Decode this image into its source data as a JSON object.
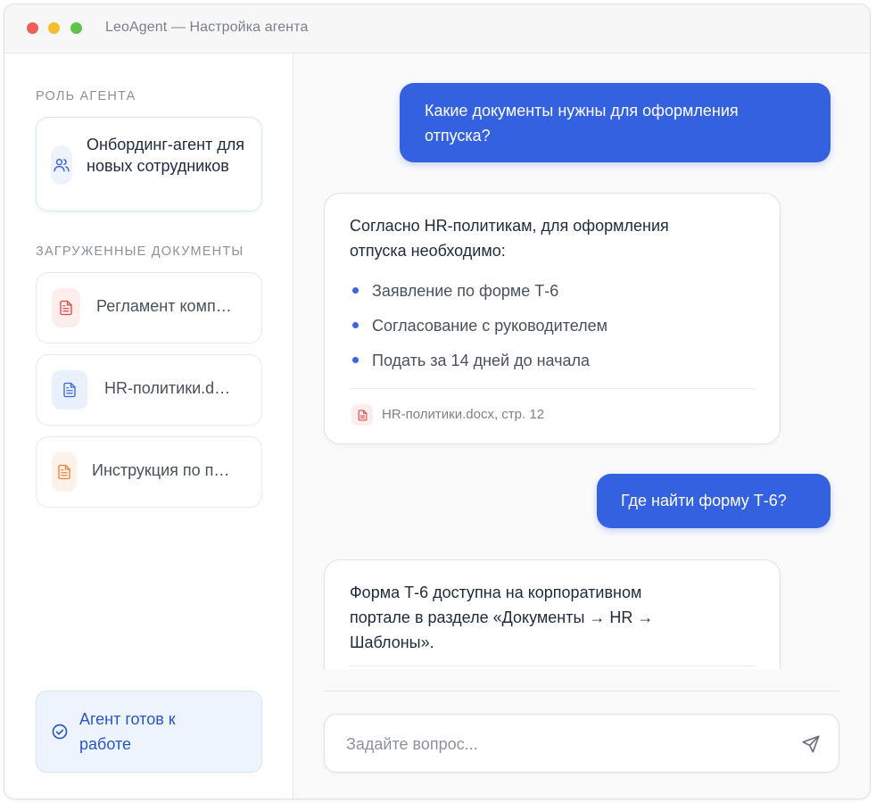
{
  "window": {
    "title": "LeoAgent — Настройка агента"
  },
  "sidebar": {
    "role_label": "РОЛЬ АГЕНТА",
    "role": {
      "icon": "users-icon",
      "text": "Онбординг-агент для новых сотрудников"
    },
    "docs_label": "ЗАГРУЖЕННЫЕ ДОКУМЕНТЫ",
    "documents": [
      {
        "name": "Регламент комп…",
        "icon": "file-text-icon",
        "color": "#d94a4a",
        "bg": "#fdeeee"
      },
      {
        "name": "HR-политики.d…",
        "icon": "file-text-icon",
        "color": "#3b67de",
        "bg": "#eaf0fc"
      },
      {
        "name": "Инструкция по п…",
        "icon": "file-text-icon",
        "color": "#e8833a",
        "bg": "#fdf1e8"
      }
    ],
    "status": {
      "text": "Агент готов к работе",
      "icon": "check-circle-icon"
    }
  },
  "chat": {
    "messages": [
      {
        "role": "user",
        "text": "Какие документы нужны для оформления отпуска?"
      },
      {
        "role": "bot",
        "text": "Согласно HR-политикам, для оформления отпуска необходимо:",
        "bullets": [
          "Заявление по форме Т-6",
          "Согласование с руководителем",
          "Подать за 14 дней до начала"
        ],
        "source": "HR-политики.docx, стр. 12"
      },
      {
        "role": "user",
        "text": "Где найти форму Т-6?"
      },
      {
        "role": "bot",
        "text": "Форма Т-6 доступна на корпоративном портале в разделе «Документы → HR → Шаблоны»."
      }
    ],
    "input": {
      "placeholder": "Задайте вопрос...",
      "value": ""
    },
    "send_icon": "send-icon"
  },
  "colors": {
    "accent": "#3361e0",
    "status_bg": "#eef4fd",
    "status_text": "#2a56c6"
  }
}
